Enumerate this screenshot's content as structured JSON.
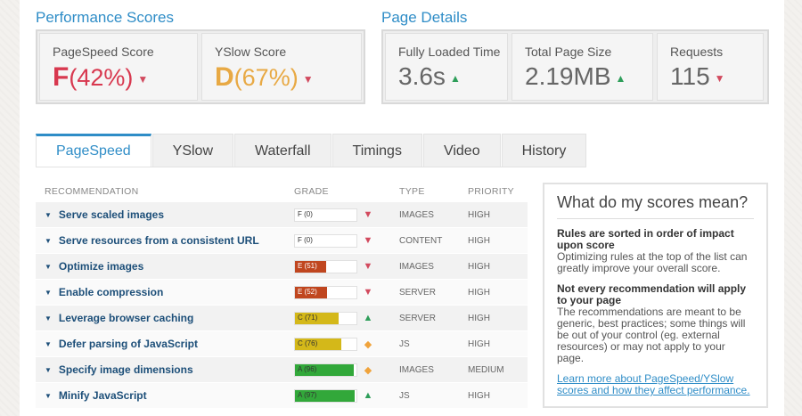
{
  "performance": {
    "title": "Performance Scores",
    "pagespeed": {
      "label": "PageSpeed Score",
      "grade": "F",
      "pct": "(42%)"
    },
    "yslow": {
      "label": "YSlow Score",
      "grade": "D",
      "pct": "(67%)"
    }
  },
  "details": {
    "title": "Page Details",
    "load": {
      "label": "Fully Loaded Time",
      "value": "3.6s"
    },
    "size": {
      "label": "Total Page Size",
      "value": "2.19MB"
    },
    "requests": {
      "label": "Requests",
      "value": "115"
    }
  },
  "tabs": [
    "PageSpeed",
    "YSlow",
    "Waterfall",
    "Timings",
    "Video",
    "History"
  ],
  "table": {
    "headers": {
      "rec": "RECOMMENDATION",
      "grade": "GRADE",
      "type": "TYPE",
      "priority": "PRIORITY"
    },
    "rows": [
      {
        "rec": "Serve scaled images",
        "grade": "F (0)",
        "score": 0,
        "color": "#ffffff",
        "icon": "down",
        "type": "IMAGES",
        "priority": "HIGH"
      },
      {
        "rec": "Serve resources from a consistent URL",
        "grade": "F (0)",
        "score": 0,
        "color": "#ffffff",
        "icon": "down",
        "type": "CONTENT",
        "priority": "HIGH"
      },
      {
        "rec": "Optimize images",
        "grade": "E (51)",
        "score": 51,
        "color": "#c0461f",
        "icon": "down",
        "type": "IMAGES",
        "priority": "HIGH"
      },
      {
        "rec": "Enable compression",
        "grade": "E (52)",
        "score": 52,
        "color": "#c0461f",
        "icon": "down",
        "type": "SERVER",
        "priority": "HIGH"
      },
      {
        "rec": "Leverage browser caching",
        "grade": "C (71)",
        "score": 71,
        "color": "#d4b819",
        "icon": "up",
        "type": "SERVER",
        "priority": "HIGH"
      },
      {
        "rec": "Defer parsing of JavaScript",
        "grade": "C (76)",
        "score": 76,
        "color": "#d4b819",
        "icon": "diamond",
        "type": "JS",
        "priority": "HIGH"
      },
      {
        "rec": "Specify image dimensions",
        "grade": "A (96)",
        "score": 96,
        "color": "#32a83a",
        "icon": "diamond",
        "type": "IMAGES",
        "priority": "MEDIUM"
      },
      {
        "rec": "Minify JavaScript",
        "grade": "A (97)",
        "score": 97,
        "color": "#32a83a",
        "icon": "up",
        "type": "JS",
        "priority": "HIGH"
      }
    ]
  },
  "sidebar": {
    "title": "What do my scores mean?",
    "h1": "Rules are sorted in order of impact upon score",
    "p1": "Optimizing rules at the top of the list can greatly improve your overall score.",
    "h2": "Not every recommendation will apply to your page",
    "p2": "The recommendations are meant to be generic, best practices; some things will be out of your control (eg. external resources) or may not apply to your page.",
    "link": "Learn more about PageSpeed/YSlow scores and how they affect performance."
  },
  "colors": {
    "accent": "#2f8dc7",
    "grade_f": "#d8384f",
    "grade_d": "#e8a944",
    "down": "#d24a5e",
    "up": "#2e9e5a",
    "warn": "#f0a33b"
  }
}
